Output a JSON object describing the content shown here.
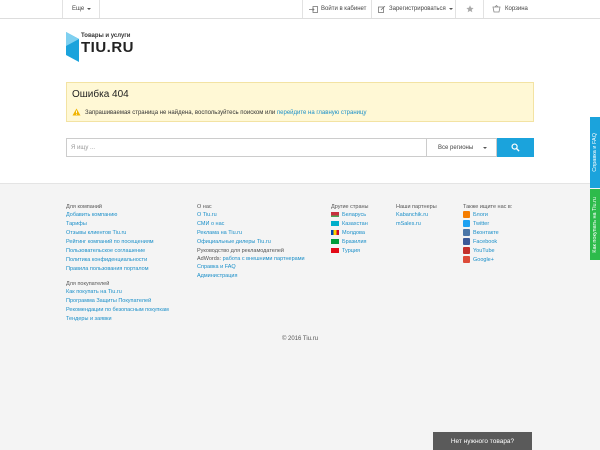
{
  "topbar": {
    "more_label": "Еще",
    "login_label": "Войти в кабинет",
    "register_label": "Зарегистрироваться",
    "cart_label": "Корзина"
  },
  "logo": {
    "subtitle": "Товары и услуги",
    "name": "TIU.RU"
  },
  "error": {
    "title": "Ошибка 404",
    "message": "Запрашиваемая страница не найдена, воспользуйтесь поиском или ",
    "link": "перейдите на главную страницу"
  },
  "search": {
    "placeholder": "Я ищу ...",
    "region": "Все регионы"
  },
  "footer": {
    "companies": {
      "title": "Для компаний",
      "links": [
        "Добавить компанию",
        "Тарифы",
        "Отзывы клиентов Tiu.ru",
        "Рейтинг компаний по посещениям",
        "Пользовательское соглашение",
        "Политика конфиденциальности",
        "Правила пользования порталом"
      ]
    },
    "buyers": {
      "title": "Для покупателей",
      "links": [
        "Как покупать на Tiu.ru",
        "Программа Защиты Покупателей",
        "Рекомендации по безопасным покупкам",
        "Тендеры и заявки"
      ]
    },
    "about": {
      "title": "О нас",
      "links": [
        "О Tiu.ru",
        "СМИ о нас",
        "Реклама на Tiu.ru",
        "Официальные дилеры Tiu.ru"
      ],
      "advert_line1": "Руководство для рекламодателей",
      "advert_prefix": "AdWords: ",
      "advert_link": "работа с внешними партнерами",
      "links2": [
        "Справка и FAQ",
        "Администрация"
      ]
    },
    "countries": {
      "title": "Другие страны",
      "items": [
        {
          "label": "Беларусь",
          "color": "#c8313e"
        },
        {
          "label": "Казахстан",
          "color": "#00afca"
        },
        {
          "label": "Молдова",
          "color": "#0046ae"
        },
        {
          "label": "Бразилия",
          "color": "#009b3a"
        },
        {
          "label": "Турция",
          "color": "#e30a17"
        }
      ]
    },
    "partners": {
      "title": "Наши партнеры",
      "links": [
        "Kabanchik.ru",
        "mSales.ru"
      ]
    },
    "social": {
      "title": "Также ищите нас в:",
      "items": [
        {
          "label": "Блоги",
          "color": "#f57d00"
        },
        {
          "label": "Twitter",
          "color": "#1da1f2"
        },
        {
          "label": "Вконтакте",
          "color": "#4a76a8"
        },
        {
          "label": "Facebook",
          "color": "#3b5998"
        },
        {
          "label": "YouTube",
          "color": "#c4302b"
        },
        {
          "label": "Google+",
          "color": "#dd4b39"
        }
      ]
    },
    "copyright": "© 2016 Tiu.ru"
  },
  "side": {
    "faq": "Справка и FAQ",
    "how_to_buy": "Как покупать на Tiu.ru"
  },
  "need_product": "Нет нужного товара?",
  "colors": {
    "accent": "#1ba3dc",
    "link": "#1a8fc9",
    "error_bg": "#fff8d5",
    "side_faq": "#1ba3dc",
    "side_buy": "#2dbb4b"
  }
}
